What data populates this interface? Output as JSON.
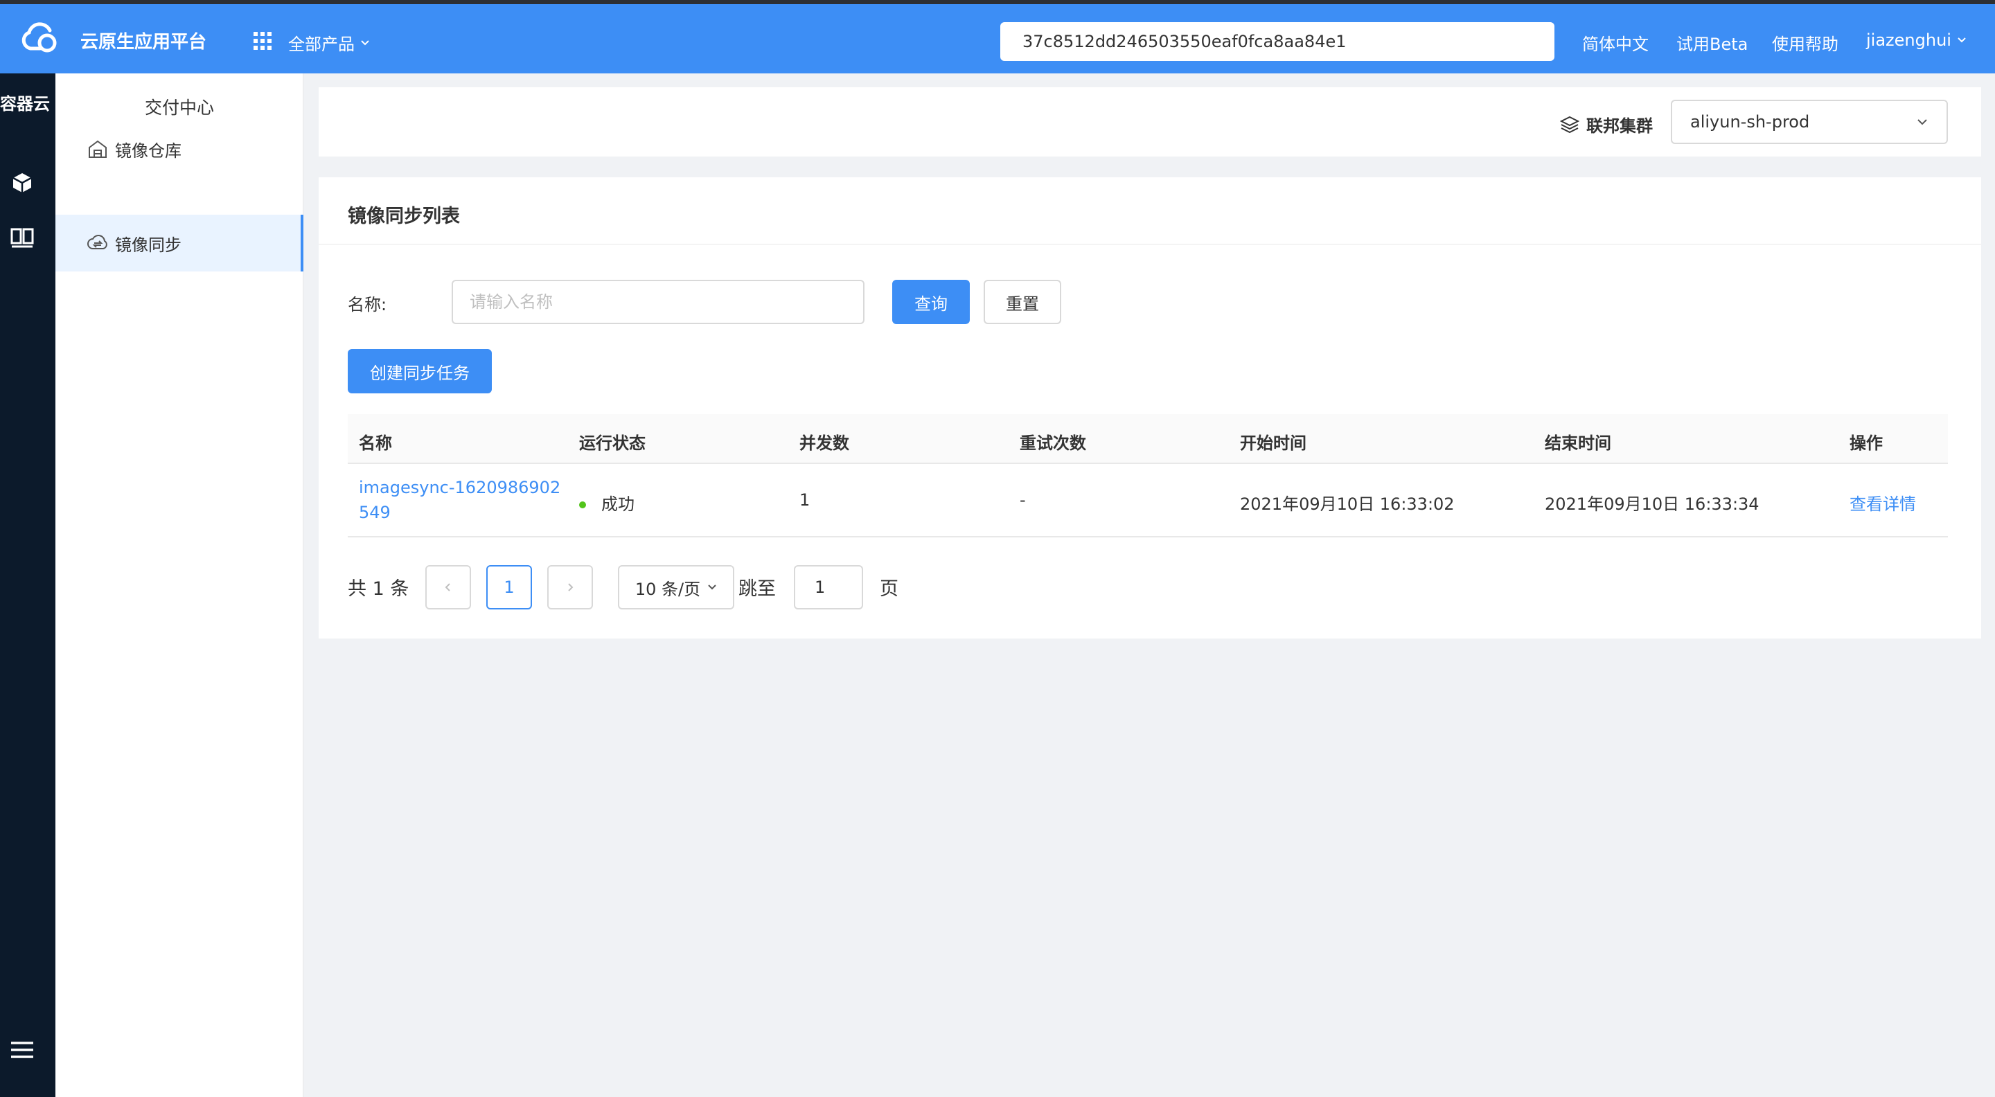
{
  "topbar": {
    "brand": "云原生应用平台",
    "products_label": "全部产品",
    "search_value": "37c8512dd246503550eaf0fca8aa84e1",
    "lang": "简体中文",
    "beta": "试用Beta",
    "help": "使用帮助",
    "user": "jiazenghui",
    "color": "#3d8ef5"
  },
  "rail": {
    "title": "容器云",
    "icons": [
      "cube-icon",
      "columns-icon",
      "menu-icon"
    ],
    "color": "#0c1a2b"
  },
  "submenu": {
    "title": "交付中心",
    "items": [
      {
        "label": "镜像仓库",
        "icon": "warehouse-icon",
        "active": false
      },
      {
        "label": "镜像同步",
        "icon": "cloud-sync-icon",
        "active": true
      }
    ]
  },
  "cluster": {
    "label": "联邦集群",
    "selected": "aliyun-sh-prod"
  },
  "main": {
    "title": "镜像同步列表",
    "filter": {
      "name_label": "名称:",
      "placeholder": "请输入名称",
      "query_btn": "查询",
      "reset_btn": "重置"
    },
    "create_btn": "创建同步任务",
    "table": {
      "columns": [
        "名称",
        "运行状态",
        "并发数",
        "重试次数",
        "开始时间",
        "结束时间",
        "操作"
      ],
      "rows": [
        {
          "name_line1": "imagesync-1620986902",
          "name_line2": "549",
          "status": "成功",
          "concurrency": "1",
          "retries": "-",
          "start": "2021年09月10日 16:33:02",
          "end": "2021年09月10日 16:33:34",
          "action": "查看详情"
        }
      ]
    },
    "pagination": {
      "total": "共 1 条",
      "current": "1",
      "page_size": "10 条/页",
      "goto_label": "跳至",
      "goto_value": "1",
      "page_suffix": "页"
    }
  }
}
